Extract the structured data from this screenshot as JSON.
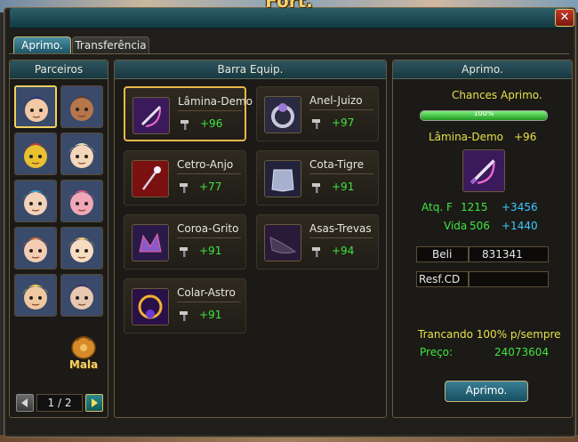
{
  "window": {
    "title": "Fort.",
    "close_label": "✕"
  },
  "tabs": [
    {
      "label": "Aprimo.",
      "active": true
    },
    {
      "label": "Transferência",
      "active": false
    }
  ],
  "partners_panel": {
    "title": "Parceiros",
    "bag_label": "Mala",
    "pagination": {
      "current": "1 / 2"
    }
  },
  "partners": [
    {
      "name": "partner-1",
      "skin": "#f2c9a4",
      "hair": "#2a2e8c",
      "selected": true
    },
    {
      "name": "partner-2",
      "skin": "#b5764a",
      "hair": "#5a3a22",
      "selected": false
    },
    {
      "name": "partner-3",
      "skin": "#e8c030",
      "hair": "#c43a30",
      "selected": false
    },
    {
      "name": "partner-4",
      "skin": "#f4d6b8",
      "hair": "#e6e0b8",
      "selected": false
    },
    {
      "name": "partner-5",
      "skin": "#f2d2b8",
      "hair": "#3aa8c8",
      "selected": false
    },
    {
      "name": "partner-6",
      "skin": "#f0a8b8",
      "hair": "#e05a80",
      "selected": false
    },
    {
      "name": "partner-7",
      "skin": "#f4cdb0",
      "hair": "#e0703a",
      "selected": false
    },
    {
      "name": "partner-8",
      "skin": "#f6dcc0",
      "hair": "#f0c860",
      "selected": false
    },
    {
      "name": "partner-9",
      "skin": "#f0c8a0",
      "hair": "#f0d040",
      "selected": false
    },
    {
      "name": "partner-10",
      "skin": "#e8c8b0",
      "hair": "#4a2a6a",
      "selected": false
    }
  ],
  "equip_panel": {
    "title": "Barra Equip."
  },
  "equipment": [
    {
      "name": "Lâmina-Demo",
      "bonus": "+96",
      "bg": "#3a1a5a",
      "glyph": "#d8d0e0",
      "selected": true,
      "icon": "blade-icon"
    },
    {
      "name": "Anel-Juizo",
      "bonus": "+97",
      "bg": "#2a2a40",
      "glyph": "#9a7ad8",
      "selected": false,
      "icon": "ring-icon"
    },
    {
      "name": "Cetro-Anjo",
      "bonus": "+77",
      "bg": "#7a1010",
      "glyph": "#c8d0e0",
      "selected": false,
      "icon": "scepter-icon"
    },
    {
      "name": "Cota-Tigre",
      "bonus": "+91",
      "bg": "#22223a",
      "glyph": "#a8b0d0",
      "selected": false,
      "icon": "armor-icon"
    },
    {
      "name": "Coroa-Grito",
      "bonus": "+91",
      "bg": "#2a1a4a",
      "glyph": "#8a5ac8",
      "selected": false,
      "icon": "crown-icon"
    },
    {
      "name": "Asas-Trevas",
      "bonus": "+94",
      "bg": "#2a1a3a",
      "glyph": "#3a2a4a",
      "selected": false,
      "icon": "wings-icon"
    },
    {
      "name": "Colar-Astro",
      "bonus": "+91",
      "bg": "#2a1048",
      "glyph": "#f0b030",
      "selected": false,
      "icon": "necklace-icon"
    }
  ],
  "upgrade_panel": {
    "title": "Aprimo.",
    "chances_label": "Chances Aprimo.",
    "chance_percent": 100,
    "chance_text": "100%",
    "item_name": "Lâmina-Demo",
    "item_bonus": "+96",
    "stats": [
      {
        "label": "Atq. F",
        "value": "1215",
        "delta": "+3456"
      },
      {
        "label": "Vida",
        "value": "506",
        "delta": "+1440"
      }
    ],
    "beli_label": "Beli",
    "beli_value": "831341",
    "resf_label": "Resf.CD",
    "resf_value": "",
    "lock_text": "Trancando 100% p/sempre",
    "price_label": "Preço:",
    "price_value": "24073604",
    "button_label": "Aprimo."
  }
}
